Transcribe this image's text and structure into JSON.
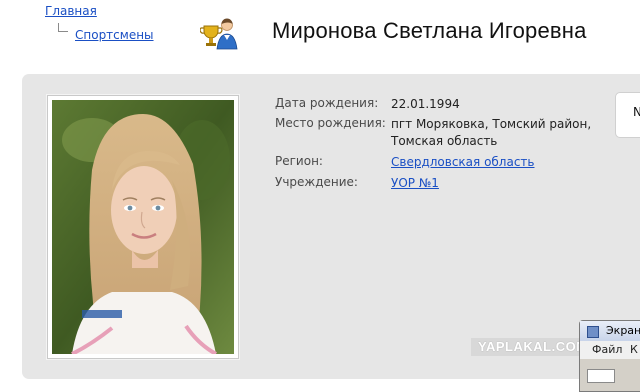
{
  "breadcrumb": {
    "home": "Главная",
    "section": "Спортсмены"
  },
  "title": "Миронова Светлана Игоревна",
  "info": [
    {
      "label": "Дата рождения:",
      "value": "22.01.1994",
      "link": false
    },
    {
      "label": "Место рождения:",
      "value_line1": "пгт Моряковка, Томский район,",
      "value_line2": "Томская область",
      "link": false
    },
    {
      "label": "Регион:",
      "value": "Свердловская область",
      "link": true
    },
    {
      "label": "Учреждение:",
      "value": "УОР №1",
      "link": true
    }
  ],
  "side_box_letter": "N",
  "watermark": "YAPLAKAL.COM",
  "window": {
    "title": "Экран",
    "menu": [
      "Файл",
      "К"
    ]
  },
  "colors": {
    "link": "#1a4fc4",
    "panel": "#e6e6e6"
  },
  "icons": {
    "athlete": "trophy-athlete-icon"
  }
}
